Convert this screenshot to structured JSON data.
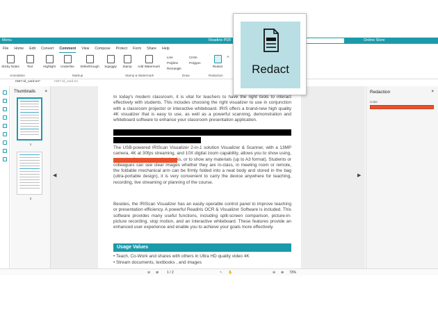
{
  "titlebar": {
    "menu": "Menu",
    "app_title": "Readiris PDF",
    "store": "Online Store"
  },
  "menus": [
    "File",
    "Home",
    "Edit",
    "Convert",
    "Comment",
    "View",
    "Compose",
    "Protect",
    "Form",
    "Share",
    "Help"
  ],
  "active_menu": "Comment",
  "ribbon": {
    "sticky": "Sticky Notes",
    "text": "Text",
    "highlight": "Highlight",
    "underline": "Underline",
    "strikethrough": "Strikethrough",
    "squiggly": "Squiggly",
    "stamp": "Stamp",
    "add_watermark": "Add Watermark",
    "line": "Line",
    "polyline": "Polyline",
    "rectangle": "Rectangle",
    "circle": "Circle",
    "polygon": "Polygon",
    "redact": "Redact",
    "more": "A",
    "groups": {
      "annotation": "Annotation",
      "markup": "Markup",
      "stamp_watermark": "Stamp & Watermark",
      "draw": "Draw",
      "redaction": "Redaction"
    }
  },
  "tabs": [
    "IS57-id_card-en*",
    "IS57-id_card-en"
  ],
  "thumbnails": {
    "title": "Thumbnails",
    "close": "×",
    "pages": [
      "1",
      "2"
    ]
  },
  "document": {
    "para1": "In today's modern classroom, it is vital for teachers to have the right tools to interact effectively with students. This includes choosing the right visualizer to use in conjunction with a classroom projector or interactive whiteboard. IRIS offers a brand-new high quality 4K visualizer that is easy to use, as well as a powerful scanning, demonstration and whiteboard software to enhance your classroom presentation application.",
    "para2": "The USB-powered IRIScan Visualizer 2-in-1 solution Visualizer & Scanner, with a 13MP camera, 4K at 30fps streaming, and 10X digital zoom capability, allows you to show                                        using, no matter for demonstrating books, or to show any materials (up to A3 format). Students or colleagues can see clear images whether they are in-class, in meeting room or remote, the foldable mechanical arm can be firmly folded into a neat body and stored in the bag (ultra-portable design), it is very convenient to carry the device anywhere for teaching, recording, live streaming or planning of the course.",
    "para3": "Besides, the IRIScan Visualizer has an easily operable control panel to improve teaching or presentation efficiency. A powerful Readiris OCR & Visualizer Software is included. This software provides many useful functions, including split-screen comparison, picture-in-picture recording, stop motion, and an interactive whiteboard. These features provide an enhanced user experience and enable you to achieve your goals more effectively.",
    "section_title": "Usage Values",
    "bullets": [
      "• Teach, Co-Work and shares with others in Ultra HD quality video 4K",
      "• Stream documents, textbooks , and images"
    ]
  },
  "redaction_panel": {
    "title": "Redaction",
    "close": "×",
    "color_label": "Color",
    "color": "#e8532b"
  },
  "status": {
    "page": "1 / 2",
    "zoom": "73%"
  },
  "callout": {
    "label": "Redact"
  },
  "colors": {
    "accent": "#1b9aaa",
    "redact_black": "#000000",
    "redact_orange": "#e8532b"
  }
}
